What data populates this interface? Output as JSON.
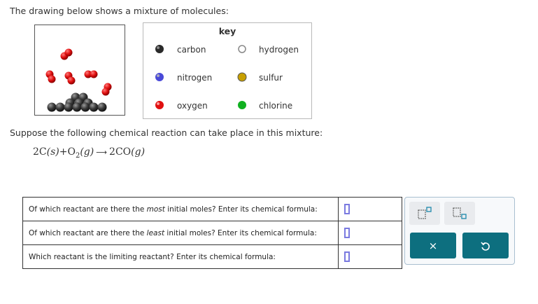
{
  "intro": "The drawing below shows a mixture of molecules:",
  "key": {
    "title": "key",
    "items": [
      {
        "label": "carbon",
        "color": "#2a2a2a",
        "icon": "carbon-atom-icon"
      },
      {
        "label": "hydrogen",
        "color": "#ffffff",
        "icon": "hydrogen-atom-icon"
      },
      {
        "label": "nitrogen",
        "color": "#4a4ad8",
        "icon": "nitrogen-atom-icon"
      },
      {
        "label": "sulfur",
        "color": "#c8a000",
        "icon": "sulfur-atom-icon"
      },
      {
        "label": "oxygen",
        "color": "#e01010",
        "icon": "oxygen-atom-icon"
      },
      {
        "label": "chlorine",
        "color": "#10b020",
        "icon": "chlorine-atom-icon"
      }
    ]
  },
  "suppose": "Suppose the following chemical reaction can take place in this mixture:",
  "equation": {
    "r1_coef": "2",
    "r1": "C",
    "r1_state": "(s)",
    "plus": "+",
    "r2": "O",
    "r2_sub": "2",
    "r2_state": "(g)",
    "p_coef": "2",
    "p": "CO",
    "p_state": "(g)"
  },
  "questions": [
    {
      "pre": "Of which reactant are there the ",
      "em": "most",
      "post": " initial moles? Enter its chemical formula:"
    },
    {
      "pre": "Of which reactant are there the ",
      "em": "least",
      "post": " initial moles? Enter its chemical formula:"
    },
    {
      "pre": "Which reactant is the limiting reactant? Enter its chemical formula:",
      "em": "",
      "post": ""
    }
  ],
  "toolbar": {
    "superscript_icon": "superscript-box-icon",
    "subscript_icon": "subscript-box-icon",
    "clear_label": "×",
    "undo_icon": "undo-icon"
  }
}
